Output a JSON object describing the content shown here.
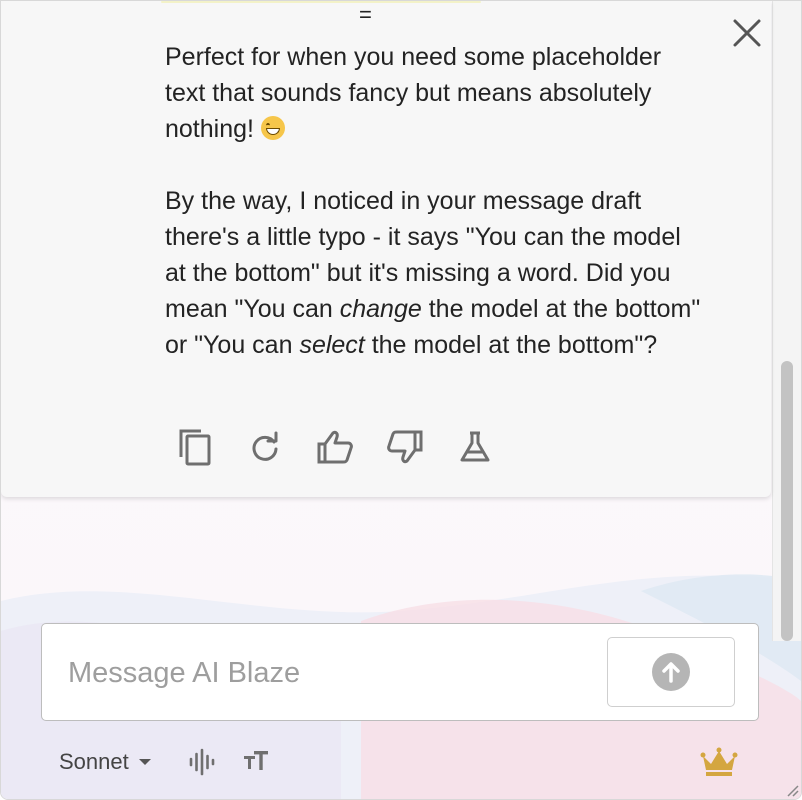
{
  "header": {
    "separator_glyph": "=",
    "close_icon": "close-icon"
  },
  "message": {
    "paragraph1": "Perfect for when you need some placeholder text that sounds fancy but means absolutely nothing!",
    "paragraph1_emoji": "grinning-face-emoji",
    "p2_before": "By the way, I noticed in your message draft there's a little typo - it says \"You can the model at the bottom\" but it's missing a word. Did you mean \"You can ",
    "p2_em1": "change",
    "p2_middle": " the model at the bottom\" or \"You can ",
    "p2_em2": "select",
    "p2_after": " the model at the bottom\"?"
  },
  "actions": [
    {
      "icon": "copy-icon"
    },
    {
      "icon": "refresh-icon"
    },
    {
      "icon": "thumbs-up-icon"
    },
    {
      "icon": "thumbs-down-icon"
    },
    {
      "icon": "flask-icon"
    }
  ],
  "composer": {
    "placeholder": "Message AI Blaze",
    "value": "",
    "send_icon": "arrow-up-icon"
  },
  "footer": {
    "model_label": "Sonnet",
    "voice_icon": "waveform-icon",
    "text_size_icon": "text-size-icon",
    "premium_icon": "crown-icon"
  },
  "colors": {
    "card_background": "#f7f7f7",
    "crown": "#d4a640",
    "send_disabled": "#b5b5b5",
    "icon_gray": "#6f6f6f"
  }
}
